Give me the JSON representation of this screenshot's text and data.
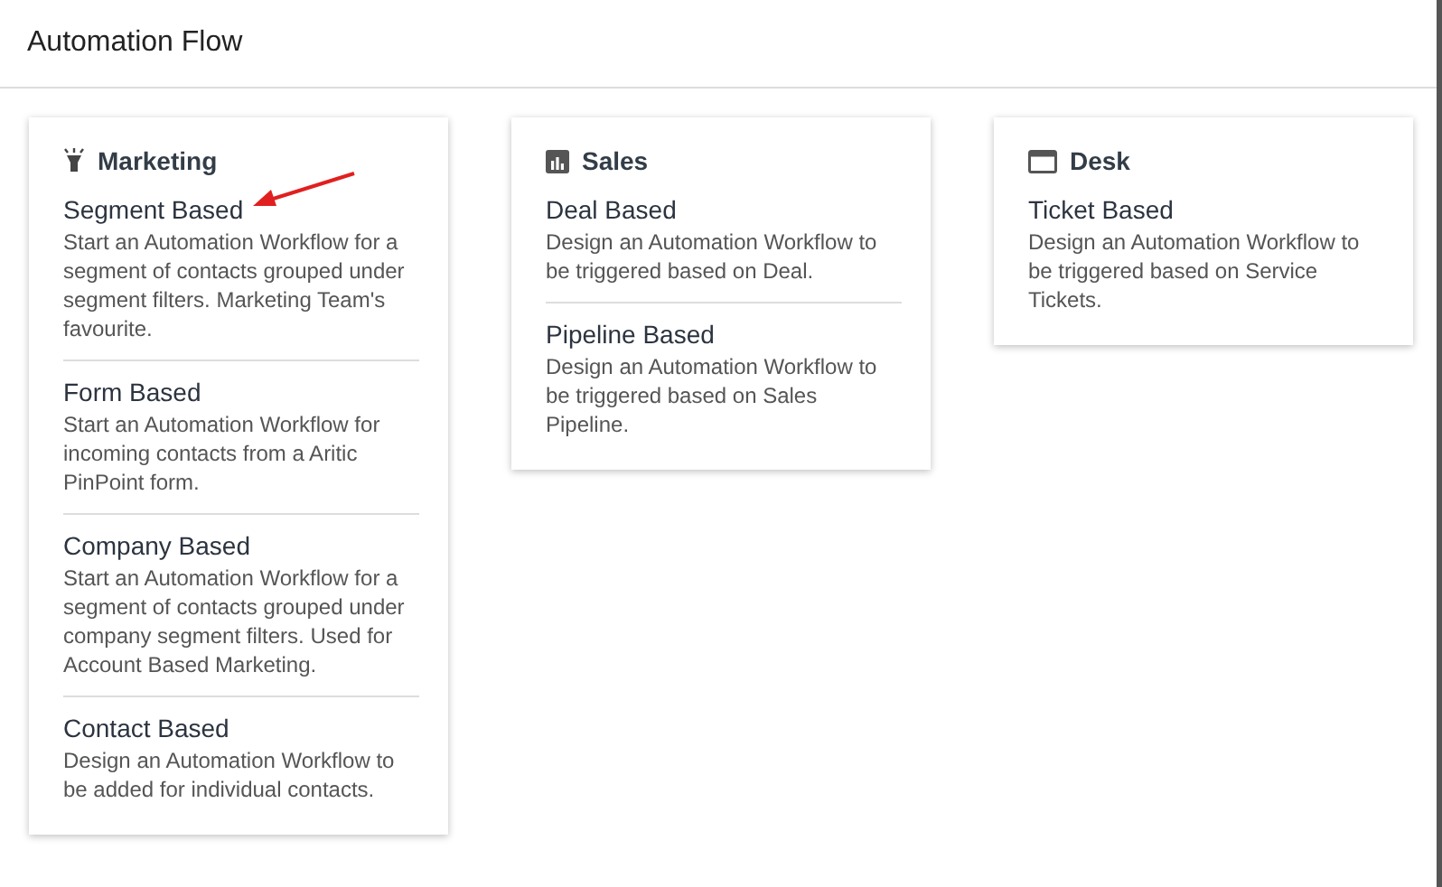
{
  "header": {
    "title": "Automation Flow"
  },
  "cards": [
    {
      "kind": "lamp",
      "title": "Marketing",
      "annotated": true,
      "items": [
        {
          "title": "Segment Based",
          "description": "Start an Automation Workflow for a segment of contacts grouped under segment filters. Marketing Team's favourite."
        },
        {
          "title": "Form Based",
          "description": "Start an Automation Workflow for incoming contacts from a Aritic PinPoint form."
        },
        {
          "title": "Company Based",
          "description": "Start an Automation Workflow for a segment of contacts grouped under company segment filters. Used for Account Based Marketing."
        },
        {
          "title": "Contact Based",
          "description": "Design an Automation Workflow to be added for individual contacts."
        }
      ]
    },
    {
      "kind": "chart",
      "title": "Sales",
      "annotated": false,
      "items": [
        {
          "title": "Deal Based",
          "description": "Design an Automation Workflow to be triggered based on Deal."
        },
        {
          "title": "Pipeline Based",
          "description": "Design an Automation Workflow to be triggered based on Sales Pipeline."
        }
      ]
    },
    {
      "kind": "window",
      "title": "Desk",
      "annotated": false,
      "items": [
        {
          "title": "Ticket Based",
          "description": "Design an Automation Workflow to be triggered based on Service Tickets."
        }
      ]
    }
  ]
}
